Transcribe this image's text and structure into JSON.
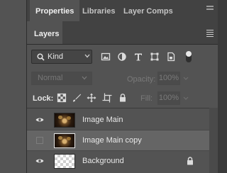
{
  "top_tabs": [
    "Properties",
    "Libraries",
    "Layer Comps"
  ],
  "panel_tab": "Layers",
  "filter": {
    "kind_label": "Kind",
    "filter_icons": [
      "image-filter-icon",
      "adjustment-filter-icon",
      "type-filter-icon",
      "shape-filter-icon",
      "smart-object-filter-icon"
    ]
  },
  "blend": {
    "mode": "Normal",
    "opacity_label": "Opacity:",
    "opacity_value": "100%"
  },
  "lock": {
    "label": "Lock:",
    "fill_label": "Fill:",
    "fill_value": "100%",
    "icons": [
      "lock-transparent-pixels-icon",
      "lock-image-pixels-icon",
      "lock-position-icon",
      "lock-artboard-icon",
      "lock-all-icon"
    ]
  },
  "layers": [
    {
      "name": "Image Main",
      "visible": true,
      "selected": false,
      "thumbnail": "image",
      "locked": false
    },
    {
      "name": "Image Main copy",
      "visible": false,
      "selected": true,
      "thumbnail": "image",
      "locked": false
    },
    {
      "name": "Background",
      "visible": true,
      "selected": false,
      "thumbnail": "transparent",
      "locked": true
    }
  ],
  "colors": {
    "panel_bg": "#535353",
    "tab_bar_bg": "#424242",
    "selected_row": "#656565"
  }
}
